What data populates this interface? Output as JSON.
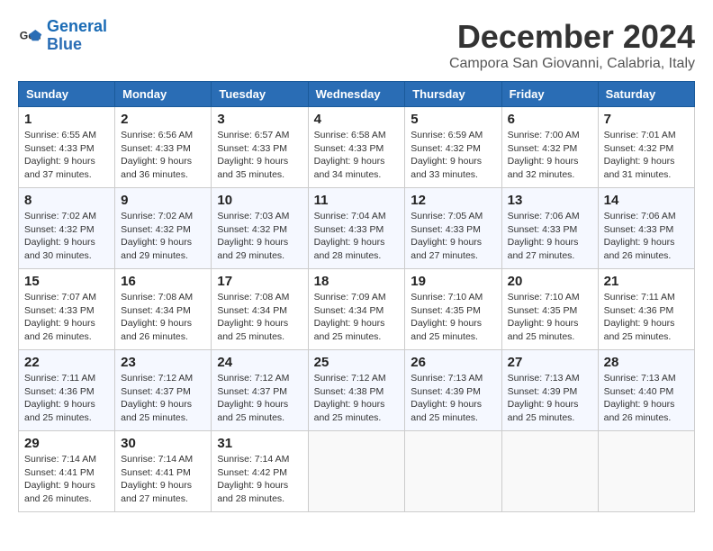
{
  "logo": {
    "line1": "General",
    "line2": "Blue"
  },
  "title": "December 2024",
  "location": "Campora San Giovanni, Calabria, Italy",
  "weekdays": [
    "Sunday",
    "Monday",
    "Tuesday",
    "Wednesday",
    "Thursday",
    "Friday",
    "Saturday"
  ],
  "weeks": [
    [
      {
        "day": "1",
        "sunrise": "6:55 AM",
        "sunset": "4:33 PM",
        "daylight": "9 hours and 37 minutes."
      },
      {
        "day": "2",
        "sunrise": "6:56 AM",
        "sunset": "4:33 PM",
        "daylight": "9 hours and 36 minutes."
      },
      {
        "day": "3",
        "sunrise": "6:57 AM",
        "sunset": "4:33 PM",
        "daylight": "9 hours and 35 minutes."
      },
      {
        "day": "4",
        "sunrise": "6:58 AM",
        "sunset": "4:33 PM",
        "daylight": "9 hours and 34 minutes."
      },
      {
        "day": "5",
        "sunrise": "6:59 AM",
        "sunset": "4:32 PM",
        "daylight": "9 hours and 33 minutes."
      },
      {
        "day": "6",
        "sunrise": "7:00 AM",
        "sunset": "4:32 PM",
        "daylight": "9 hours and 32 minutes."
      },
      {
        "day": "7",
        "sunrise": "7:01 AM",
        "sunset": "4:32 PM",
        "daylight": "9 hours and 31 minutes."
      }
    ],
    [
      {
        "day": "8",
        "sunrise": "7:02 AM",
        "sunset": "4:32 PM",
        "daylight": "9 hours and 30 minutes."
      },
      {
        "day": "9",
        "sunrise": "7:02 AM",
        "sunset": "4:32 PM",
        "daylight": "9 hours and 29 minutes."
      },
      {
        "day": "10",
        "sunrise": "7:03 AM",
        "sunset": "4:32 PM",
        "daylight": "9 hours and 29 minutes."
      },
      {
        "day": "11",
        "sunrise": "7:04 AM",
        "sunset": "4:33 PM",
        "daylight": "9 hours and 28 minutes."
      },
      {
        "day": "12",
        "sunrise": "7:05 AM",
        "sunset": "4:33 PM",
        "daylight": "9 hours and 27 minutes."
      },
      {
        "day": "13",
        "sunrise": "7:06 AM",
        "sunset": "4:33 PM",
        "daylight": "9 hours and 27 minutes."
      },
      {
        "day": "14",
        "sunrise": "7:06 AM",
        "sunset": "4:33 PM",
        "daylight": "9 hours and 26 minutes."
      }
    ],
    [
      {
        "day": "15",
        "sunrise": "7:07 AM",
        "sunset": "4:33 PM",
        "daylight": "9 hours and 26 minutes."
      },
      {
        "day": "16",
        "sunrise": "7:08 AM",
        "sunset": "4:34 PM",
        "daylight": "9 hours and 26 minutes."
      },
      {
        "day": "17",
        "sunrise": "7:08 AM",
        "sunset": "4:34 PM",
        "daylight": "9 hours and 25 minutes."
      },
      {
        "day": "18",
        "sunrise": "7:09 AM",
        "sunset": "4:34 PM",
        "daylight": "9 hours and 25 minutes."
      },
      {
        "day": "19",
        "sunrise": "7:10 AM",
        "sunset": "4:35 PM",
        "daylight": "9 hours and 25 minutes."
      },
      {
        "day": "20",
        "sunrise": "7:10 AM",
        "sunset": "4:35 PM",
        "daylight": "9 hours and 25 minutes."
      },
      {
        "day": "21",
        "sunrise": "7:11 AM",
        "sunset": "4:36 PM",
        "daylight": "9 hours and 25 minutes."
      }
    ],
    [
      {
        "day": "22",
        "sunrise": "7:11 AM",
        "sunset": "4:36 PM",
        "daylight": "9 hours and 25 minutes."
      },
      {
        "day": "23",
        "sunrise": "7:12 AM",
        "sunset": "4:37 PM",
        "daylight": "9 hours and 25 minutes."
      },
      {
        "day": "24",
        "sunrise": "7:12 AM",
        "sunset": "4:37 PM",
        "daylight": "9 hours and 25 minutes."
      },
      {
        "day": "25",
        "sunrise": "7:12 AM",
        "sunset": "4:38 PM",
        "daylight": "9 hours and 25 minutes."
      },
      {
        "day": "26",
        "sunrise": "7:13 AM",
        "sunset": "4:39 PM",
        "daylight": "9 hours and 25 minutes."
      },
      {
        "day": "27",
        "sunrise": "7:13 AM",
        "sunset": "4:39 PM",
        "daylight": "9 hours and 25 minutes."
      },
      {
        "day": "28",
        "sunrise": "7:13 AM",
        "sunset": "4:40 PM",
        "daylight": "9 hours and 26 minutes."
      }
    ],
    [
      {
        "day": "29",
        "sunrise": "7:14 AM",
        "sunset": "4:41 PM",
        "daylight": "9 hours and 26 minutes."
      },
      {
        "day": "30",
        "sunrise": "7:14 AM",
        "sunset": "4:41 PM",
        "daylight": "9 hours and 27 minutes."
      },
      {
        "day": "31",
        "sunrise": "7:14 AM",
        "sunset": "4:42 PM",
        "daylight": "9 hours and 28 minutes."
      },
      null,
      null,
      null,
      null
    ]
  ]
}
